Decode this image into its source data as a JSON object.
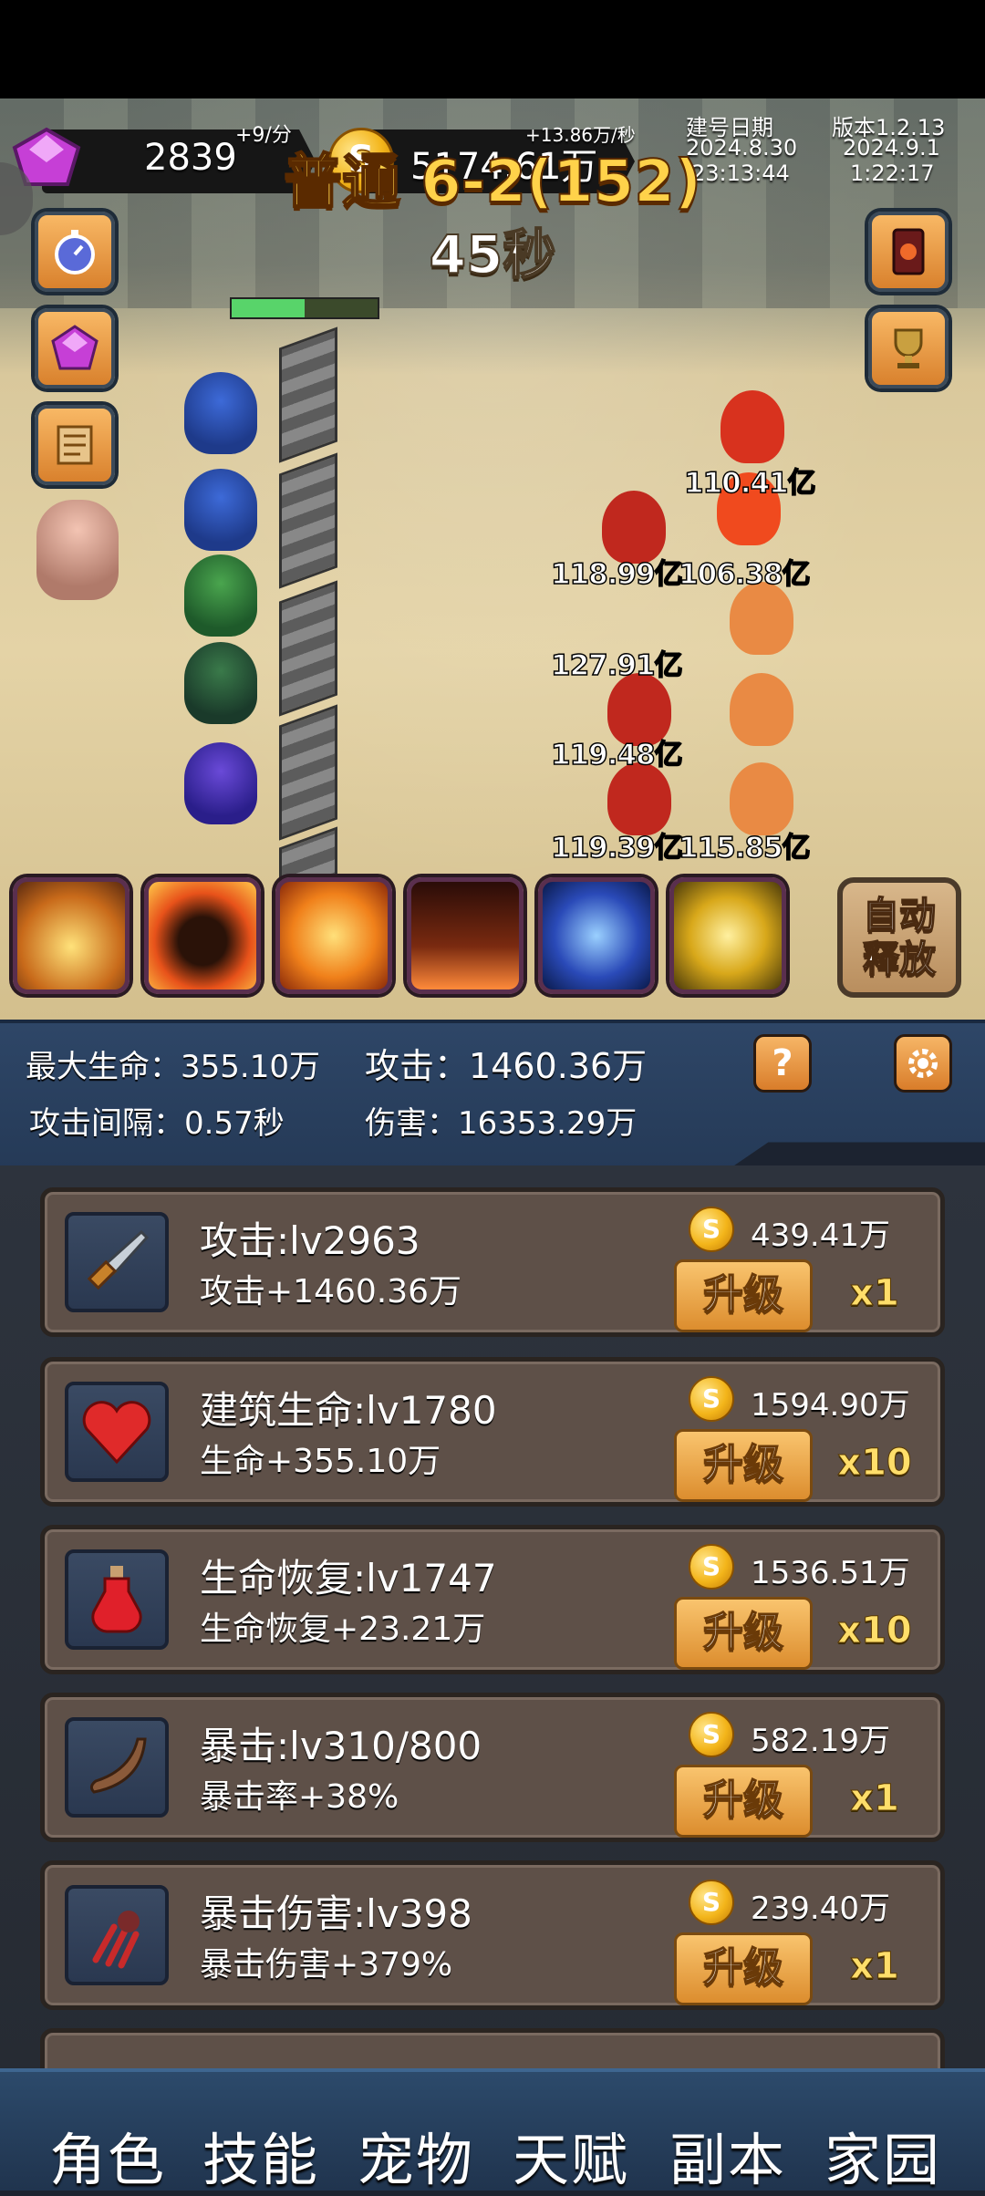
{
  "resources": {
    "gems": "2839",
    "gem_rate": "+9/分",
    "gold": "5174.61万",
    "gold_rate": "+13.86万/秒"
  },
  "build_info": {
    "build_date_label": "建号日期",
    "build_date": "2024.8.30",
    "build_time": "23:13:44",
    "version_label": "版本1.2.13",
    "version_date": "2024.9.1",
    "version_time": "1:22:17"
  },
  "stage": {
    "title": "普通 6-2(152)",
    "timer": "45秒",
    "progress": 0.5
  },
  "damage_numbers": [
    "110.41亿",
    "118.99亿",
    "106.38亿",
    "127.91亿",
    "119.48亿",
    "119.39亿",
    "115.85亿"
  ],
  "side_buttons_left": [
    "stopwatch-icon",
    "gem-icon",
    "scroll-icon"
  ],
  "side_buttons_right": [
    "card-icon",
    "trophy-icon"
  ],
  "skills": [
    "shockwave-skill",
    "rage-skill",
    "fire-demon-skill",
    "eruption-skill",
    "lightning-skill",
    "vortex-skill"
  ],
  "auto_release": "自动\n释放",
  "stats": {
    "max_hp_label": "最大生命：",
    "max_hp": "355.10万",
    "attack_label": "攻击：",
    "attack": "1460.36万",
    "interval_label": "攻击间隔：",
    "interval": "0.57秒",
    "damage_label": "伤害：",
    "damage": "16353.29万"
  },
  "upgrades": [
    {
      "icon": "dagger-icon",
      "name": "攻击:lv2963",
      "effect": "攻击+1460.36万",
      "cost": "439.41万",
      "button": "升级",
      "multiplier": "x1"
    },
    {
      "icon": "heart-icon",
      "name": "建筑生命:lv1780",
      "effect": "生命+355.10万",
      "cost": "1594.90万",
      "button": "升级",
      "multiplier": "x10"
    },
    {
      "icon": "potion-icon",
      "name": "生命恢复:lv1747",
      "effect": "生命恢复+23.21万",
      "cost": "1536.51万",
      "button": "升级",
      "multiplier": "x10"
    },
    {
      "icon": "horn-icon",
      "name": "暴击:lv310/800",
      "effect": "暴击率+38%",
      "cost": "582.19万",
      "button": "升级",
      "multiplier": "x1"
    },
    {
      "icon": "claw-icon",
      "name": "暴击伤害:lv398",
      "effect": "暴击伤害+379%",
      "cost": "239.40万",
      "button": "升级",
      "multiplier": "x1"
    }
  ],
  "nav": [
    "角色",
    "技能",
    "宠物",
    "天赋",
    "副本",
    "家园"
  ],
  "colors": {
    "gold": "#f3b51a",
    "button": "#dc8d2e",
    "panel": "#2e4667",
    "card": "#5e5048",
    "title": "#ffd24a"
  }
}
